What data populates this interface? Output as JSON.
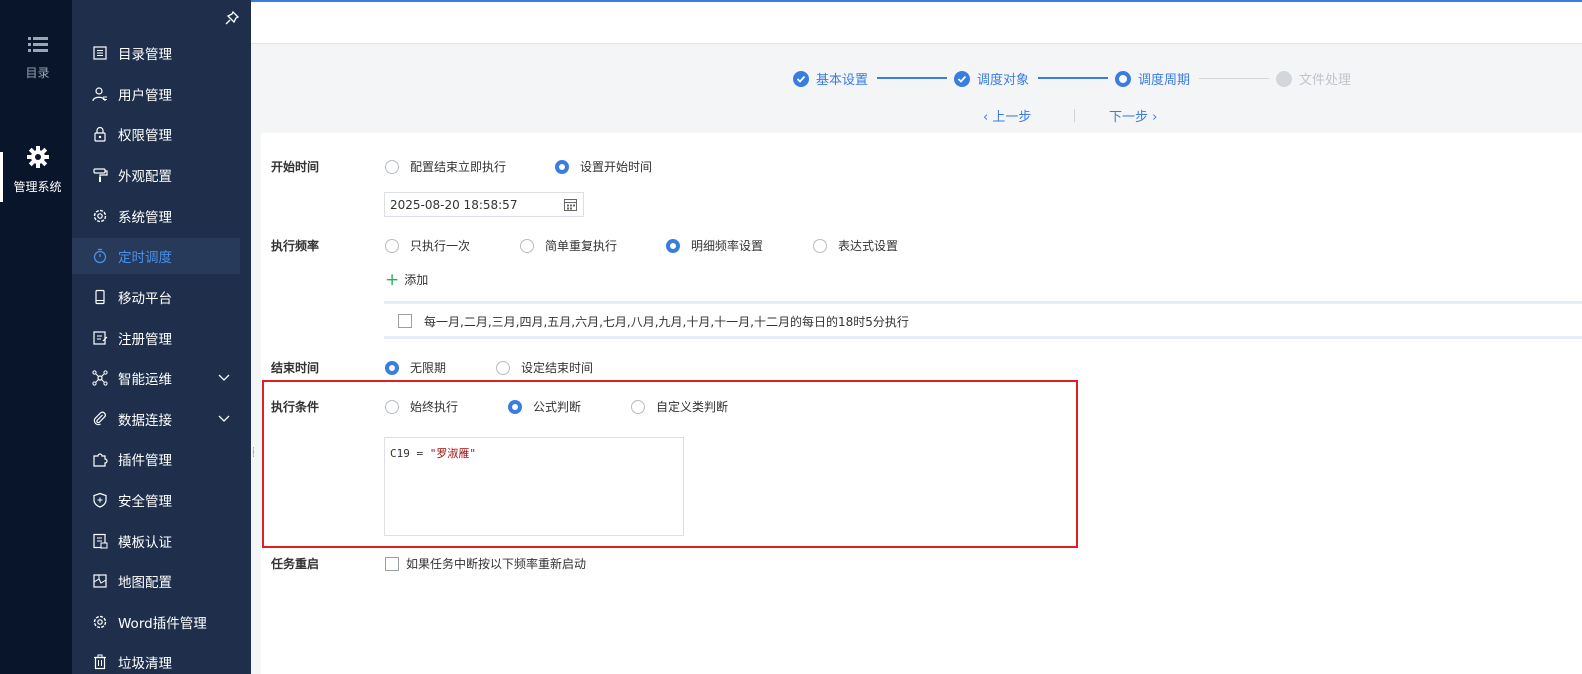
{
  "rail": {
    "items": [
      {
        "label": "目录",
        "icon": "list-icon"
      },
      {
        "label": "管理系统",
        "icon": "gear-icon"
      }
    ]
  },
  "menu": {
    "items": [
      {
        "label": "目录管理",
        "icon": "catalog-icon"
      },
      {
        "label": "用户管理",
        "icon": "user-icon"
      },
      {
        "label": "权限管理",
        "icon": "lock-icon"
      },
      {
        "label": "外观配置",
        "icon": "paint-roller-icon"
      },
      {
        "label": "系统管理",
        "icon": "settings-icon"
      },
      {
        "label": "定时调度",
        "icon": "timer-icon"
      },
      {
        "label": "移动平台",
        "icon": "mobile-icon"
      },
      {
        "label": "注册管理",
        "icon": "register-icon"
      },
      {
        "label": "智能运维",
        "icon": "network-icon"
      },
      {
        "label": "数据连接",
        "icon": "link-icon"
      },
      {
        "label": "插件管理",
        "icon": "puzzle-icon"
      },
      {
        "label": "安全管理",
        "icon": "shield-icon"
      },
      {
        "label": "模板认证",
        "icon": "template-icon"
      },
      {
        "label": "地图配置",
        "icon": "map-icon"
      },
      {
        "label": "Word插件管理",
        "icon": "settings-icon"
      },
      {
        "label": "垃圾清理",
        "icon": "trash-icon"
      }
    ],
    "active": "定时调度"
  },
  "steps": [
    {
      "label": "基本设置",
      "state": "done"
    },
    {
      "label": "调度对象",
      "state": "done"
    },
    {
      "label": "调度周期",
      "state": "current"
    },
    {
      "label": "文件处理",
      "state": "todo"
    }
  ],
  "nav": {
    "prev": "上一步",
    "next": "下一步"
  },
  "form": {
    "start_time": {
      "label": "开始时间",
      "options": [
        "配置结束立即执行",
        "设置开始时间"
      ],
      "selected": "设置开始时间",
      "datetime": "2025-08-20 18:58:57"
    },
    "frequency": {
      "label": "执行频率",
      "options": [
        "只执行一次",
        "简单重复执行",
        "明细频率设置",
        "表达式设置"
      ],
      "selected": "明细频率设置",
      "add_label": "添加",
      "rule": "每一月,二月,三月,四月,五月,六月,七月,八月,九月,十月,十一月,十二月的每日的18时5分执行"
    },
    "end_time": {
      "label": "结束时间",
      "options": [
        "无限期",
        "设定结束时间"
      ],
      "selected": "无限期"
    },
    "condition": {
      "label": "执行条件",
      "options": [
        "始终执行",
        "公式判断",
        "自定义类判断"
      ],
      "selected": "公式判断",
      "formula_cell": "C19 = ",
      "formula_value": "\"罗淑雁\""
    },
    "restart": {
      "label": "任务重启",
      "checkbox_label": "如果任务中断按以下频率重新启动"
    }
  },
  "colors": {
    "accent": "#3a7de0",
    "highlight": "#e02020",
    "rail_bg": "#09152a",
    "menu_bg": "#1f2f4b"
  }
}
